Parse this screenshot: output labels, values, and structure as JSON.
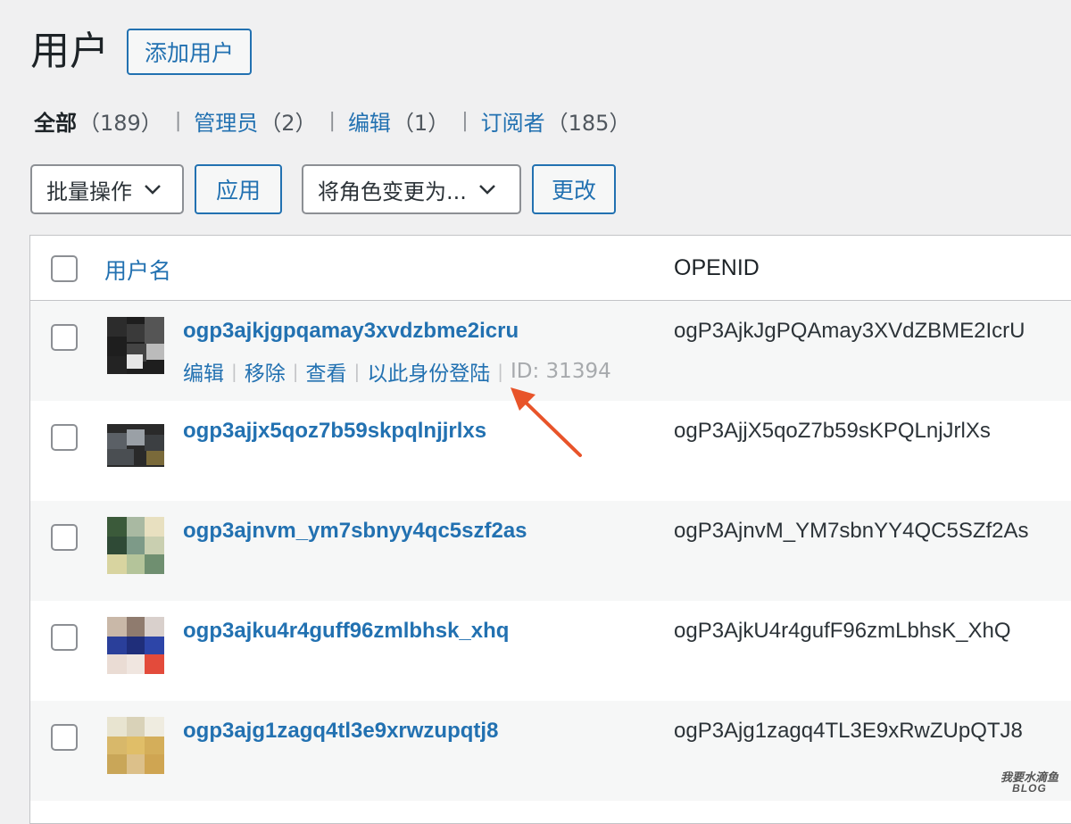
{
  "header": {
    "title": "用户",
    "add_button": "添加用户"
  },
  "filters": [
    {
      "label": "全部",
      "count": "（189）",
      "current": true
    },
    {
      "label": "管理员",
      "count": "（2）",
      "current": false
    },
    {
      "label": "编辑",
      "count": "（1）",
      "current": false
    },
    {
      "label": "订阅者",
      "count": "（185）",
      "current": false
    }
  ],
  "separator": "|",
  "actions": {
    "bulk_select": "批量操作",
    "apply_button": "应用",
    "role_select": "将角色变更为...",
    "change_button": "更改"
  },
  "table": {
    "columns": {
      "username": "用户名",
      "openid": "OPENID"
    },
    "rows": [
      {
        "username": "ogp3ajkjgpqamay3xvdzbme2icru",
        "openid": "ogP3AjkJgPQAmay3XVdZBME2IcrU"
      },
      {
        "username": "ogp3ajjx5qoz7b59skpqlnjjrlxs",
        "openid": "ogP3AjjX5qoZ7b59sKPQLnjJrlXs"
      },
      {
        "username": "ogp3ajnvm_ym7sbnyy4qc5szf2as",
        "openid": "ogP3AjnvM_YM7sbnYY4QC5SZf2As"
      },
      {
        "username": "ogp3ajku4r4guff96zmlbhsk_xhq",
        "openid": "ogP3AjkU4r4gufF96zmLbhsK_XhQ"
      },
      {
        "username": "ogp3ajg1zagq4tl3e9xrwzupqtj8",
        "openid": "ogP3Ajg1zagq4TL3E9xRwZUpQTJ8"
      }
    ],
    "row_actions": {
      "edit": "编辑",
      "remove": "移除",
      "view": "查看",
      "login_as": "以此身份登陆",
      "id_text": "ID: 31394"
    }
  },
  "watermark": {
    "line1": "我要水滴鱼",
    "line2": "BLOG"
  },
  "colors": {
    "link": "#2271b1",
    "arrow": "#e8542a",
    "bg": "#f0f0f1"
  }
}
